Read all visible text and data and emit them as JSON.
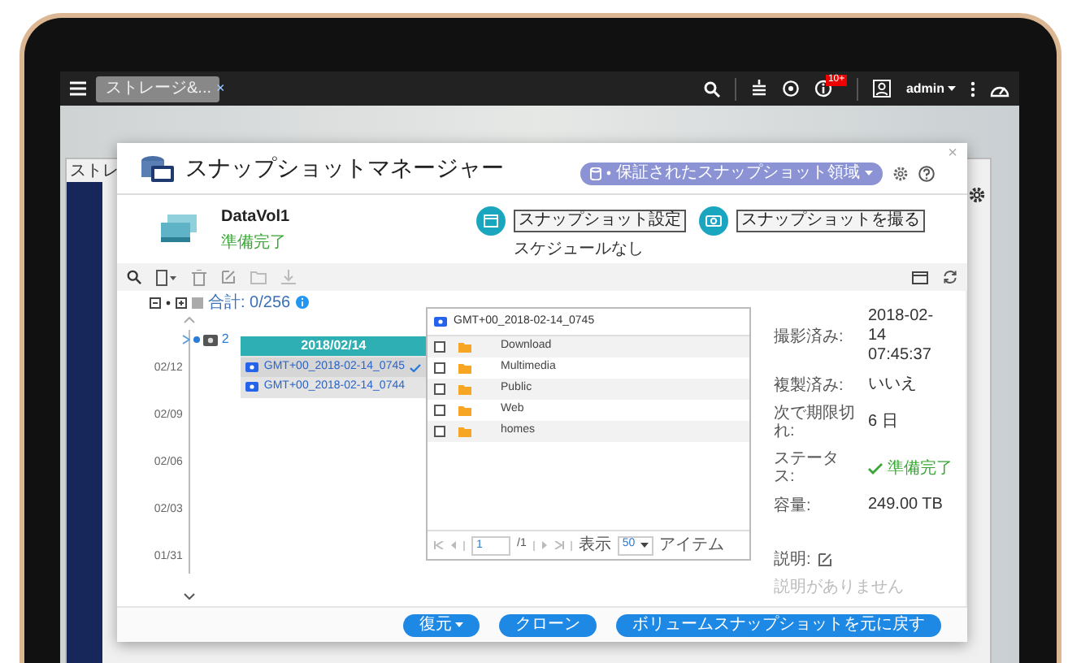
{
  "taskbar": {
    "app_tab": "ストレージ&...",
    "app_tab_close": "×",
    "notification_badge": "10+",
    "user": "admin"
  },
  "background_window": {
    "title": "ストレ"
  },
  "dialog": {
    "title": "スナップショットマネージャー",
    "close": "×",
    "space_button": "保証されたスナップショット領域"
  },
  "volume": {
    "name": "DataVol1",
    "status": "準備完了"
  },
  "actions": [
    {
      "label": "スナップショット設定",
      "note": "スケジュールなし"
    },
    {
      "label": "スナップショットを撮る"
    }
  ],
  "tree_total": "合計: 0/256",
  "timeline": {
    "count": "2",
    "dates": [
      "02/12",
      "02/09",
      "02/06",
      "02/03",
      "01/31"
    ]
  },
  "snapshot_group": {
    "date": "2018/02/14",
    "snapshots": [
      {
        "name": "GMT+00_2018-02-14_0745",
        "selected": true
      },
      {
        "name": "GMT+00_2018-02-14_0744",
        "selected": false
      }
    ]
  },
  "browser": {
    "title": "GMT+00_2018-02-14_0745",
    "folders": [
      {
        "name": "Download",
        "checked": false
      },
      {
        "name": "Multimedia",
        "checked": false
      },
      {
        "name": "Public",
        "checked": false
      },
      {
        "name": "Web",
        "checked": false
      },
      {
        "name": "homes",
        "checked": false
      }
    ],
    "page": "1",
    "page_total": "/1",
    "show_label": "表示",
    "page_size": "50",
    "items_label": "アイテム"
  },
  "details": [
    {
      "label": "撮影済み:",
      "value": "2018-02-14 07:45:37",
      "kind": "text"
    },
    {
      "label": "複製済み:",
      "value": "いいえ",
      "kind": "text"
    },
    {
      "label": "次で期限切れ:",
      "value": "6 日",
      "kind": "text"
    },
    {
      "label": "ステータス:",
      "value": "準備完了",
      "kind": "status"
    },
    {
      "label": "容量:",
      "value": "249.00 TB",
      "kind": "text"
    }
  ],
  "description": {
    "label": "説明:",
    "placeholder": "説明がありません"
  },
  "buttons": [
    {
      "label": "復元",
      "dropdown": true
    },
    {
      "label": "クローン",
      "dropdown": false
    },
    {
      "label": "ボリュームスナップショットを元に戻す",
      "dropdown": false
    }
  ]
}
